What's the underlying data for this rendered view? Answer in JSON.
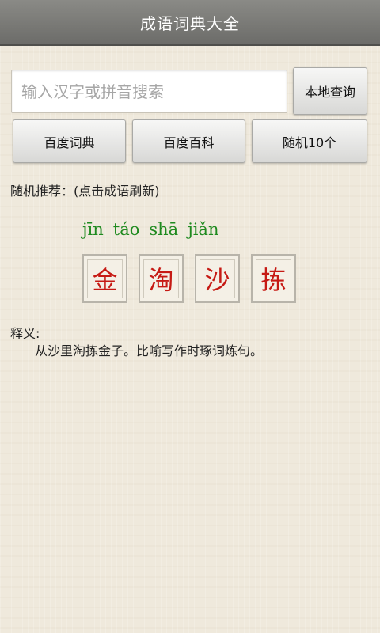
{
  "app": {
    "title": "成语词典大全"
  },
  "search": {
    "placeholder": "输入汉字或拼音搜索",
    "value": "",
    "local_button": "本地查询"
  },
  "actions": {
    "baidu_dict": "百度词典",
    "baidu_baike": "百度百科",
    "random10": "随机10个"
  },
  "recommend": {
    "label": "随机推荐：(点击成语刷新)",
    "pinyin": [
      "jīn",
      "táo",
      "shā",
      "jiǎn"
    ],
    "chars": [
      "金",
      "淘",
      "沙",
      "拣"
    ],
    "meaning_label": "释义:",
    "meaning": "从沙里淘拣金子。比喻写作时琢词炼句。"
  },
  "colors": {
    "title_bar": "#7b7b78",
    "pinyin": "#1f8a1f",
    "idiom_char": "#c61a14",
    "background": "#efe9dc"
  }
}
